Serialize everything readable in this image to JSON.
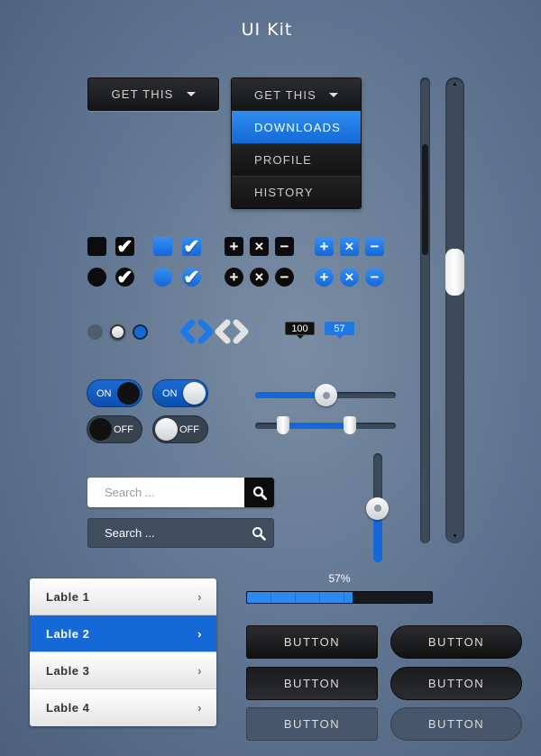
{
  "title": "UI Kit",
  "dropdown_button": {
    "label": "GET THIS"
  },
  "dropdown_menu": {
    "label": "GET THIS",
    "items": [
      "DOWNLOADS",
      "PROFILE",
      "HISTORY"
    ],
    "active": "DOWNLOADS"
  },
  "badges": [
    "100",
    "57"
  ],
  "toggles": {
    "on": "ON",
    "off": "OFF"
  },
  "search": {
    "placeholder_light": "Search ...",
    "placeholder_dark": "Search ..."
  },
  "progress": {
    "label": "57%",
    "value": 57
  },
  "sliders": {
    "single": 50,
    "range": [
      20,
      67
    ],
    "vertical": 50
  },
  "list": {
    "items": [
      "Lable 1",
      "Lable 2",
      "Lable 3",
      "Lable 4"
    ],
    "active": "Lable 2"
  },
  "buttons": {
    "label": "BUTTON"
  },
  "colors": {
    "accent": "#1469d6",
    "dark": "#141516",
    "background": "#5f7490"
  }
}
